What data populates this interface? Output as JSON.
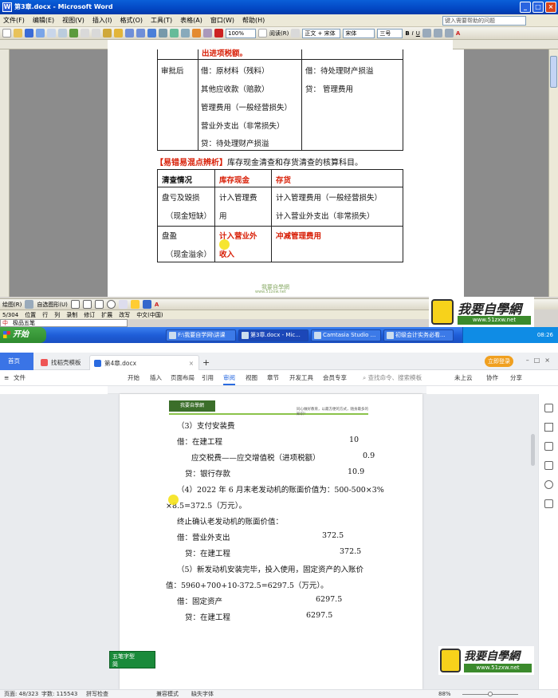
{
  "top_window": {
    "title": "第3章.docx - Microsoft Word",
    "menu": [
      "文件(F)",
      "编辑(E)",
      "视图(V)",
      "插入(I)",
      "格式(O)",
      "工具(T)",
      "表格(A)",
      "窗口(W)",
      "帮助(H)"
    ],
    "help_placeholder": "键入需要帮助的问题",
    "zoom": "100%",
    "read_mode": "阅读(R)",
    "style": "正文 + 宋体",
    "font": "宋体",
    "size": "三号",
    "doc": {
      "cut_heading": "出进项税额。",
      "approved_label": "审批后",
      "debit_lines": [
        "借：原材料（残料）",
        "其他应收款（赔款）",
        "管理费用（一般经营损失）",
        "营业外支出（非常损失）",
        "贷：待处理财产损溢"
      ],
      "right_lines": [
        "借：待处理财产损溢",
        "贷：  管理费用"
      ],
      "confuse_bracket": "【易错易混点辨析】",
      "confuse_text": "库存现金清查和存货清查的核算科目。",
      "table_headers": [
        "清查情况",
        "库存现金",
        "存货"
      ],
      "row1": {
        "c1a": "盘亏及毁损",
        "c1b": "（现金短缺）",
        "c2a": "计入管理费",
        "c2b": "用",
        "c3a": "计入管理费用（一般经营损失）",
        "c3b": "计入营业外支出（非常损失）"
      },
      "row2": {
        "c1a": "盘盈",
        "c1b": "（现金溢余）",
        "c2a": "计入营业外",
        "c2b": "收入",
        "c3a": "冲减管理费用"
      }
    },
    "footer_brand": "我要自學網",
    "footer_url": "www.51zxw.net",
    "draw_bar": {
      "draw": "绘图(R)",
      "autoshape": "自选图形(U)"
    },
    "status": {
      "page": "5/304",
      "pos": "位置",
      "items": [
        "行",
        "列",
        "录制",
        "修订",
        "扩展",
        "改写"
      ],
      "lang": "中文(中国)"
    },
    "ime_label": "极品五笔",
    "taskbar": {
      "start": "开始",
      "tasks": [
        "F:\\我要自学网\\讲课",
        "第3章.docx - Mic...",
        "Camtasia Studio ...",
        "初级会计实务必看..."
      ],
      "clock": "08:26"
    }
  },
  "bottom_window": {
    "tabs": {
      "home": "首页",
      "t1": "找稻壳模板",
      "t2": "第4章.docx"
    },
    "top_right": {
      "login": "立即登录"
    },
    "menu": [
      "文件",
      "开始",
      "插入",
      "页面布局",
      "引用",
      "审阅",
      "视图",
      "章节",
      "开发工具",
      "会员专享"
    ],
    "active_menu": "审阅",
    "search": "查找命令、搜索模板",
    "right_actions": [
      "未上云",
      "协作",
      "分享"
    ],
    "page_header_text": "同心做好教育，以最方便的方式，随身最多的知识！",
    "lines": {
      "l1": "（3）支付安装费",
      "l2a": "借：在建工程",
      "l2b": "10",
      "l3a": "应交税费——应交增值税（进项税额）",
      "l3b": "0.9",
      "l4a": "贷：银行存款",
      "l4b": "10.9",
      "l5": "（4）2022 年 6 月末老发动机的账面价值为：500-500×3%",
      "l6": "×8.5=372.5（万元）。",
      "l7": "终止确认老发动机的账面价值：",
      "l8a": "借：营业外支出",
      "l8b": "372.5",
      "l9a": "贷：在建工程",
      "l9b": "372.5",
      "l10": "（5）新发动机安装完毕，投入使用，固定资产的入账价",
      "l11": "值：5960+700+10-372.5=6297.5（万元）。",
      "l12a": "借：固定资产",
      "l12b": "6297.5",
      "l13a": "贷：在建工程",
      "l13b": "6297.5"
    },
    "status": {
      "page": "页面: 48/323",
      "words": "字数: 115543",
      "spell": "拼写检查",
      "compat": "兼容模式",
      "font_missing": "缺失字体",
      "zoom": "88%"
    },
    "ime": {
      "line1": "五笔字型",
      "line2": "简"
    },
    "logo_brand": "我要自學網",
    "logo_url": "www.51zxw.net"
  }
}
